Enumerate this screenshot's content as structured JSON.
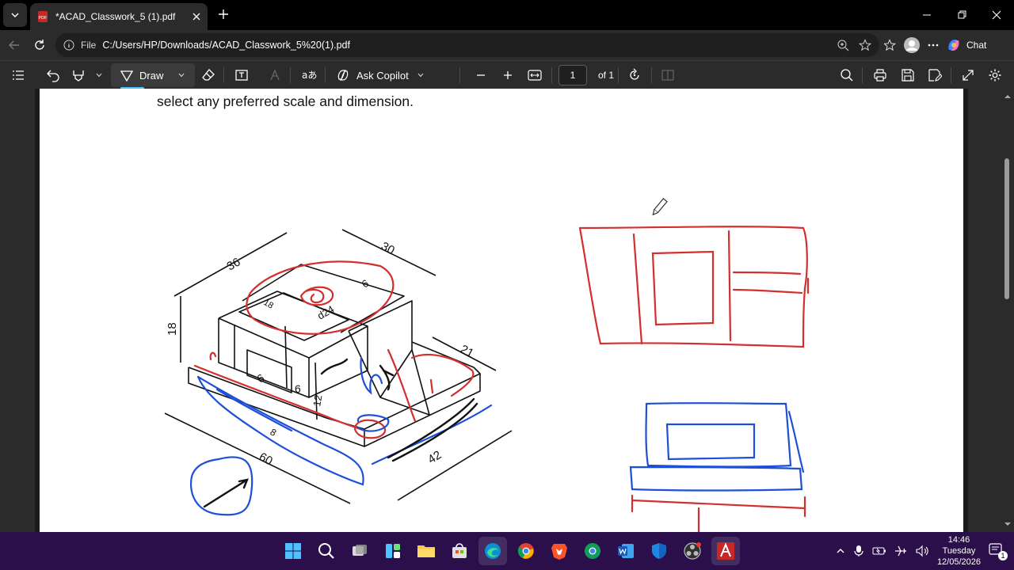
{
  "browser": {
    "tab_title": "*ACAD_Classwork_5 (1).pdf",
    "url_label": "File",
    "url": "C:/Users/HP/Downloads/ACAD_Classwork_5%20(1).pdf",
    "chat_label": "Chat"
  },
  "pdf_toolbar": {
    "draw_label": "Draw",
    "copilot_label": "Ask Copilot",
    "page_number": "1",
    "page_total": "of 1",
    "icons": [
      "contents-icon",
      "undo-icon",
      "highlight-icon",
      "draw-icon",
      "eraser-icon",
      "textbox-icon",
      "text-color-icon",
      "read-aloud-icon",
      "copilot-icon",
      "zoom-out-icon",
      "zoom-in-icon",
      "fit-page-icon",
      "rotate-icon",
      "page-view-icon",
      "search-icon",
      "print-icon",
      "save-icon",
      "save-as-icon",
      "fullscreen-icon",
      "settings-icon"
    ]
  },
  "document": {
    "text": "select any preferred scale and dimension.",
    "dimensions": [
      "36",
      "30",
      "18",
      "6",
      "18",
      "d24",
      "21",
      "6",
      "6",
      "12",
      "8",
      "60",
      "42"
    ],
    "ink_colors": {
      "red": "#d32f2f",
      "blue": "#1e4fd8",
      "black": "#111111"
    }
  },
  "taskbar": {
    "time": "14:46",
    "day": "Tuesday",
    "date": "12/05/2026",
    "notification_count": "1"
  }
}
